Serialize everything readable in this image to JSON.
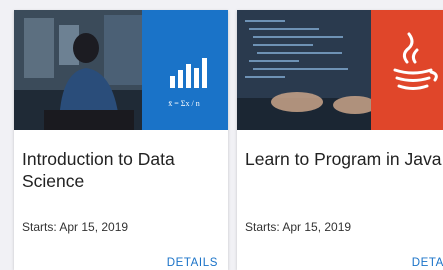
{
  "courses": [
    {
      "title": "Introduction to Data Science",
      "start": "Starts: Apr 15, 2019",
      "details_label": "DETAILS",
      "formula": "x̄ = Σx / n",
      "accent": "#1a73c8"
    },
    {
      "title": "Learn to Program in Java",
      "start": "Starts: Apr 15, 2019",
      "details_label": "DETAILS",
      "accent": "#e0462a"
    }
  ]
}
